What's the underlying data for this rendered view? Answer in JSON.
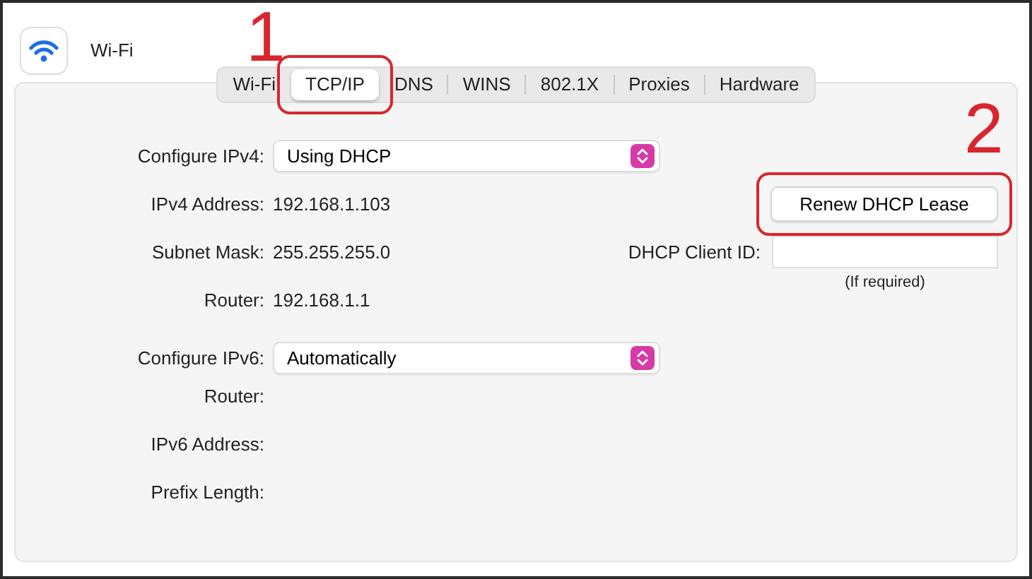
{
  "window": {
    "title": "Wi-Fi"
  },
  "tabs": [
    {
      "label": "Wi-Fi",
      "selected": false
    },
    {
      "label": "TCP/IP",
      "selected": true
    },
    {
      "label": "DNS",
      "selected": false
    },
    {
      "label": "WINS",
      "selected": false
    },
    {
      "label": "802.1X",
      "selected": false
    },
    {
      "label": "Proxies",
      "selected": false
    },
    {
      "label": "Hardware",
      "selected": false
    }
  ],
  "ipv4": {
    "configure": {
      "label": "Configure IPv4:",
      "value": "Using DHCP"
    },
    "rows": [
      {
        "label": "IPv4 Address:",
        "value": "192.168.1.103"
      },
      {
        "label": "Subnet Mask:",
        "value": "255.255.255.0"
      },
      {
        "label": "Router:",
        "value": "192.168.1.1"
      }
    ]
  },
  "renew_button": "Renew DHCP Lease",
  "dhcp_client_id": {
    "label": "DHCP Client ID:",
    "hint": "(If required)"
  },
  "ipv6": {
    "configure": {
      "label": "Configure IPv6:",
      "value": "Automatically"
    },
    "rows": [
      {
        "label": "Router:"
      },
      {
        "label": "IPv6 Address:"
      },
      {
        "label": "Prefix Length:"
      }
    ]
  },
  "annotations": [
    {
      "number": "1"
    },
    {
      "number": "2"
    }
  ]
}
